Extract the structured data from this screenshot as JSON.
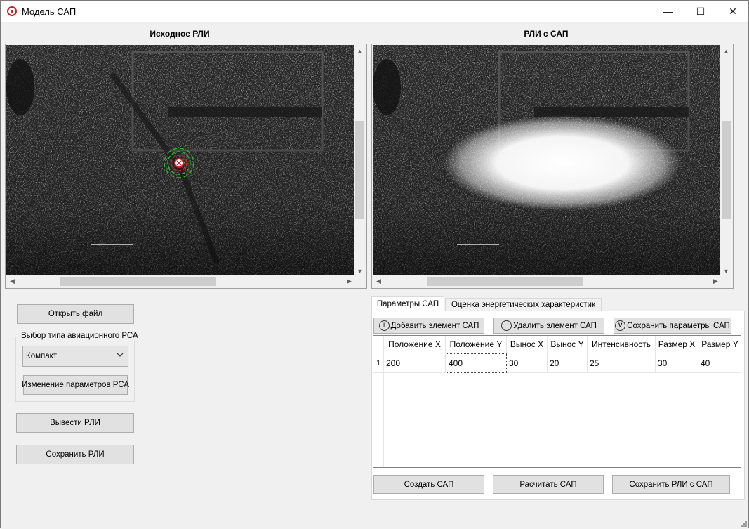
{
  "window": {
    "title": "Модель САП",
    "minimize": "—",
    "maximize": "☐",
    "close": "✕"
  },
  "left_view": {
    "heading": "Исходное РЛИ"
  },
  "right_view": {
    "heading": "РЛИ с САП"
  },
  "scroll_arrows": {
    "up": "▲",
    "down": "▼",
    "left": "◀",
    "right": "▶"
  },
  "left_panel": {
    "open_file": "Открыть файл",
    "rsa_group_label": "Выбор типа авиационного РСА",
    "rsa_type_selected": "Компакт",
    "change_rsa_params": "Изменение параметров РСА",
    "show_image": "Вывести РЛИ",
    "save_image": "Сохранить РЛИ"
  },
  "tabs": {
    "params": "Параметры САП",
    "energy": "Оценка энергетических характеристик"
  },
  "toolbar": {
    "add": "Добавить элемент САП",
    "remove": "Удалить элемент САП",
    "save_params": "Сохранить параметры САП",
    "add_icon": "+",
    "remove_icon": "−",
    "save_icon": "∨"
  },
  "table": {
    "headers": [
      "Положение X",
      "Положение Y",
      "Вынос X",
      "Вынос Y",
      "Интенсивность",
      "Размер X",
      "Размер Y"
    ],
    "rows": [
      {
        "index": "1",
        "cells": [
          "200",
          "400",
          "30",
          "20",
          "25",
          "30",
          "40"
        ]
      }
    ]
  },
  "bottom_buttons": {
    "create": "Создать САП",
    "calculate": "Расчитать САП",
    "save_with": "Сохранить РЛИ с САП"
  },
  "colors": {
    "marker_red": "#d42020",
    "marker_green": "#22b822"
  }
}
